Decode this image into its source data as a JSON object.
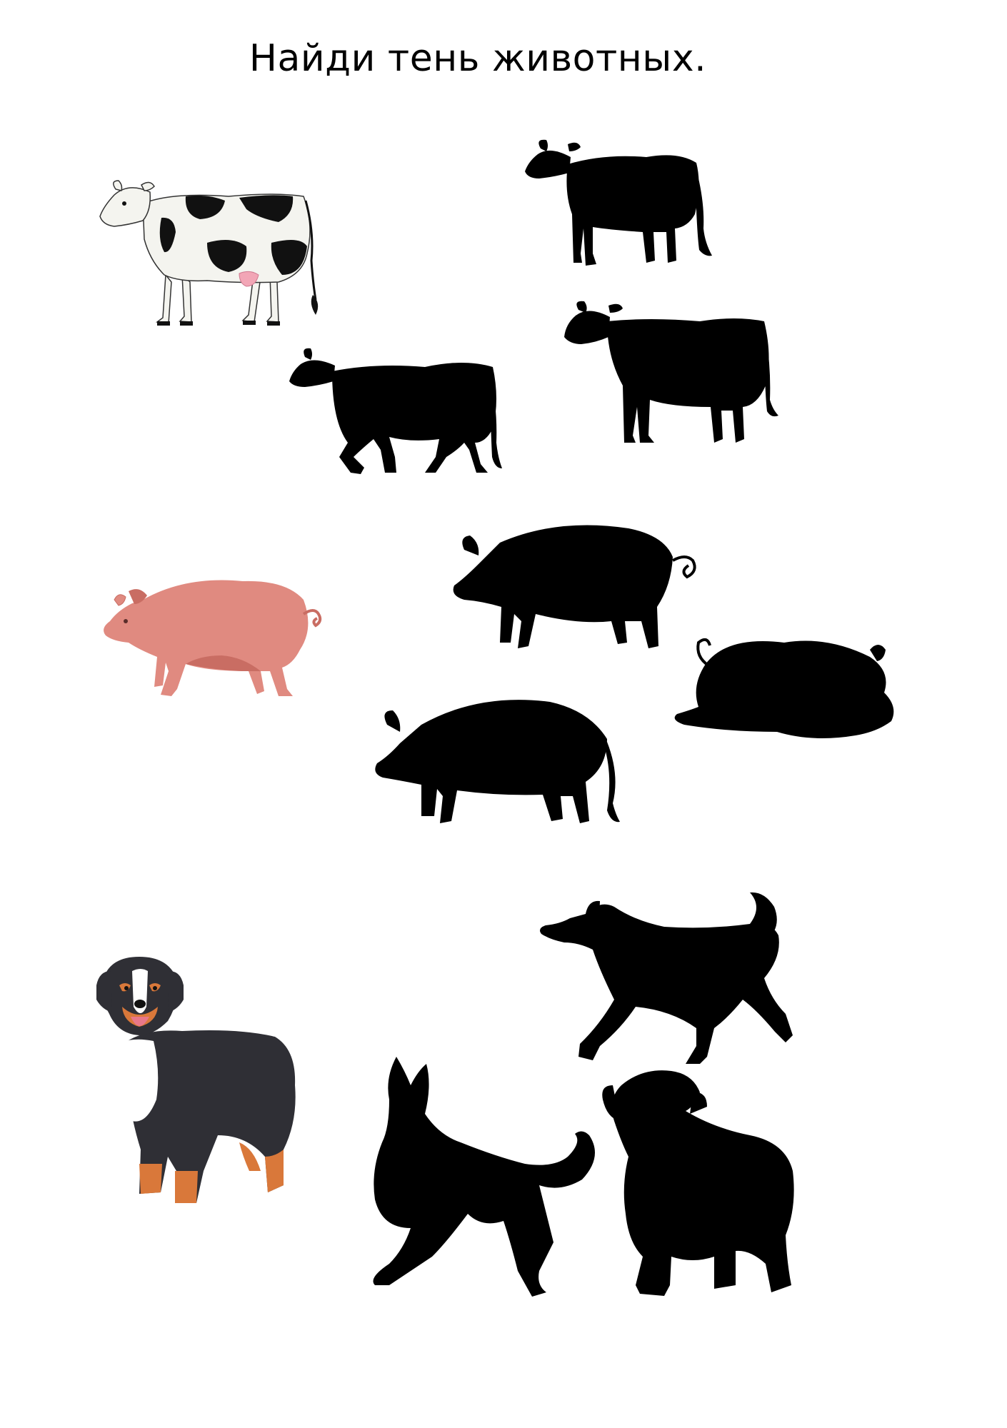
{
  "worksheet": {
    "title": "Найди тень животных."
  },
  "colors": {
    "silhouette": "#000000",
    "pig_body": "#e08a80",
    "pig_shade": "#c96d63",
    "cow_body": "#f4f4ef",
    "cow_spots": "#111111",
    "cow_udder": "#f2a6b6",
    "dog_black": "#2f2f35",
    "dog_tan": "#d9783a",
    "dog_white": "#ffffff"
  },
  "pictures": [
    {
      "name": "cow-picture",
      "kind": "cow"
    },
    {
      "name": "pig-picture",
      "kind": "pig"
    },
    {
      "name": "dog-picture",
      "kind": "dog"
    }
  ],
  "shadows": [
    {
      "name": "cow-shadow-standing",
      "kind": "cow"
    },
    {
      "name": "cow-shadow-walking",
      "kind": "cow"
    },
    {
      "name": "cow-shadow-large",
      "kind": "cow"
    },
    {
      "name": "pig-shadow-standing",
      "kind": "pig"
    },
    {
      "name": "pig-shadow-lying",
      "kind": "pig"
    },
    {
      "name": "pig-shadow-boar",
      "kind": "pig"
    },
    {
      "name": "dog-shadow-trotting",
      "kind": "dog"
    },
    {
      "name": "dog-shadow-shepherd",
      "kind": "dog"
    },
    {
      "name": "dog-shadow-sitting-pup",
      "kind": "dog"
    }
  ]
}
